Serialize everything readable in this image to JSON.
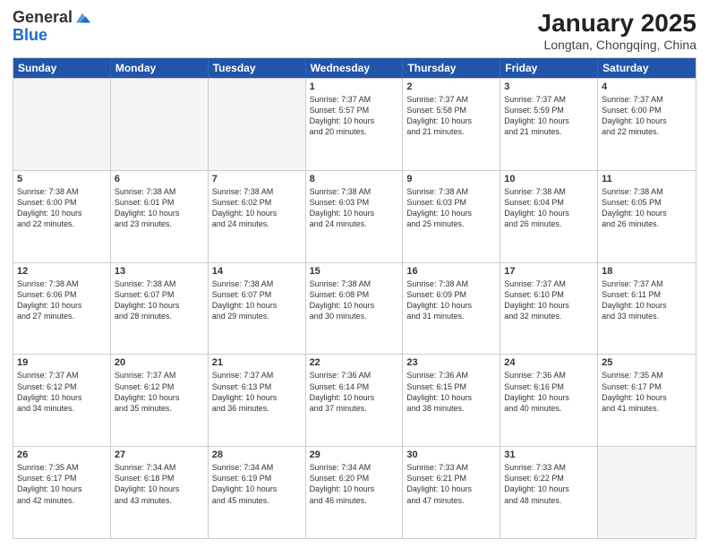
{
  "header": {
    "logo_line1": "General",
    "logo_line2": "Blue",
    "month_title": "January 2025",
    "location": "Longtan, Chongqing, China"
  },
  "days_of_week": [
    "Sunday",
    "Monday",
    "Tuesday",
    "Wednesday",
    "Thursday",
    "Friday",
    "Saturday"
  ],
  "weeks": [
    [
      {
        "day": "",
        "text": "",
        "empty": true
      },
      {
        "day": "",
        "text": "",
        "empty": true
      },
      {
        "day": "",
        "text": "",
        "empty": true
      },
      {
        "day": "1",
        "text": "Sunrise: 7:37 AM\nSunset: 5:57 PM\nDaylight: 10 hours\nand 20 minutes.",
        "empty": false
      },
      {
        "day": "2",
        "text": "Sunrise: 7:37 AM\nSunset: 5:58 PM\nDaylight: 10 hours\nand 21 minutes.",
        "empty": false
      },
      {
        "day": "3",
        "text": "Sunrise: 7:37 AM\nSunset: 5:59 PM\nDaylight: 10 hours\nand 21 minutes.",
        "empty": false
      },
      {
        "day": "4",
        "text": "Sunrise: 7:37 AM\nSunset: 6:00 PM\nDaylight: 10 hours\nand 22 minutes.",
        "empty": false
      }
    ],
    [
      {
        "day": "5",
        "text": "Sunrise: 7:38 AM\nSunset: 6:00 PM\nDaylight: 10 hours\nand 22 minutes.",
        "empty": false
      },
      {
        "day": "6",
        "text": "Sunrise: 7:38 AM\nSunset: 6:01 PM\nDaylight: 10 hours\nand 23 minutes.",
        "empty": false
      },
      {
        "day": "7",
        "text": "Sunrise: 7:38 AM\nSunset: 6:02 PM\nDaylight: 10 hours\nand 24 minutes.",
        "empty": false
      },
      {
        "day": "8",
        "text": "Sunrise: 7:38 AM\nSunset: 6:03 PM\nDaylight: 10 hours\nand 24 minutes.",
        "empty": false
      },
      {
        "day": "9",
        "text": "Sunrise: 7:38 AM\nSunset: 6:03 PM\nDaylight: 10 hours\nand 25 minutes.",
        "empty": false
      },
      {
        "day": "10",
        "text": "Sunrise: 7:38 AM\nSunset: 6:04 PM\nDaylight: 10 hours\nand 26 minutes.",
        "empty": false
      },
      {
        "day": "11",
        "text": "Sunrise: 7:38 AM\nSunset: 6:05 PM\nDaylight: 10 hours\nand 26 minutes.",
        "empty": false
      }
    ],
    [
      {
        "day": "12",
        "text": "Sunrise: 7:38 AM\nSunset: 6:06 PM\nDaylight: 10 hours\nand 27 minutes.",
        "empty": false
      },
      {
        "day": "13",
        "text": "Sunrise: 7:38 AM\nSunset: 6:07 PM\nDaylight: 10 hours\nand 28 minutes.",
        "empty": false
      },
      {
        "day": "14",
        "text": "Sunrise: 7:38 AM\nSunset: 6:07 PM\nDaylight: 10 hours\nand 29 minutes.",
        "empty": false
      },
      {
        "day": "15",
        "text": "Sunrise: 7:38 AM\nSunset: 6:08 PM\nDaylight: 10 hours\nand 30 minutes.",
        "empty": false
      },
      {
        "day": "16",
        "text": "Sunrise: 7:38 AM\nSunset: 6:09 PM\nDaylight: 10 hours\nand 31 minutes.",
        "empty": false
      },
      {
        "day": "17",
        "text": "Sunrise: 7:37 AM\nSunset: 6:10 PM\nDaylight: 10 hours\nand 32 minutes.",
        "empty": false
      },
      {
        "day": "18",
        "text": "Sunrise: 7:37 AM\nSunset: 6:11 PM\nDaylight: 10 hours\nand 33 minutes.",
        "empty": false
      }
    ],
    [
      {
        "day": "19",
        "text": "Sunrise: 7:37 AM\nSunset: 6:12 PM\nDaylight: 10 hours\nand 34 minutes.",
        "empty": false
      },
      {
        "day": "20",
        "text": "Sunrise: 7:37 AM\nSunset: 6:12 PM\nDaylight: 10 hours\nand 35 minutes.",
        "empty": false
      },
      {
        "day": "21",
        "text": "Sunrise: 7:37 AM\nSunset: 6:13 PM\nDaylight: 10 hours\nand 36 minutes.",
        "empty": false
      },
      {
        "day": "22",
        "text": "Sunrise: 7:36 AM\nSunset: 6:14 PM\nDaylight: 10 hours\nand 37 minutes.",
        "empty": false
      },
      {
        "day": "23",
        "text": "Sunrise: 7:36 AM\nSunset: 6:15 PM\nDaylight: 10 hours\nand 38 minutes.",
        "empty": false
      },
      {
        "day": "24",
        "text": "Sunrise: 7:36 AM\nSunset: 6:16 PM\nDaylight: 10 hours\nand 40 minutes.",
        "empty": false
      },
      {
        "day": "25",
        "text": "Sunrise: 7:35 AM\nSunset: 6:17 PM\nDaylight: 10 hours\nand 41 minutes.",
        "empty": false
      }
    ],
    [
      {
        "day": "26",
        "text": "Sunrise: 7:35 AM\nSunset: 6:17 PM\nDaylight: 10 hours\nand 42 minutes.",
        "empty": false
      },
      {
        "day": "27",
        "text": "Sunrise: 7:34 AM\nSunset: 6:18 PM\nDaylight: 10 hours\nand 43 minutes.",
        "empty": false
      },
      {
        "day": "28",
        "text": "Sunrise: 7:34 AM\nSunset: 6:19 PM\nDaylight: 10 hours\nand 45 minutes.",
        "empty": false
      },
      {
        "day": "29",
        "text": "Sunrise: 7:34 AM\nSunset: 6:20 PM\nDaylight: 10 hours\nand 46 minutes.",
        "empty": false
      },
      {
        "day": "30",
        "text": "Sunrise: 7:33 AM\nSunset: 6:21 PM\nDaylight: 10 hours\nand 47 minutes.",
        "empty": false
      },
      {
        "day": "31",
        "text": "Sunrise: 7:33 AM\nSunset: 6:22 PM\nDaylight: 10 hours\nand 48 minutes.",
        "empty": false
      },
      {
        "day": "",
        "text": "",
        "empty": true
      }
    ]
  ]
}
